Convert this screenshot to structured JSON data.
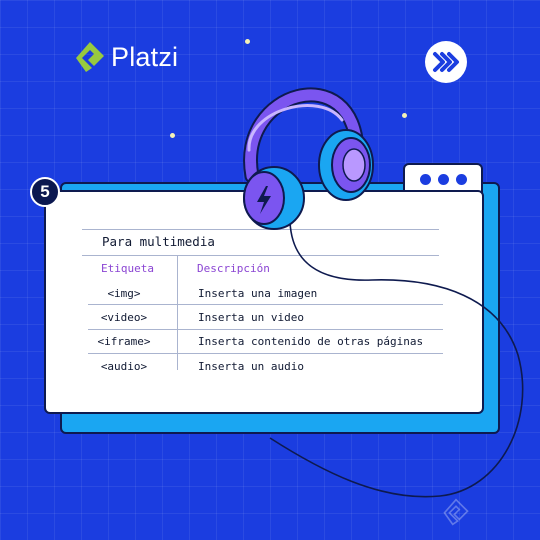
{
  "brand": {
    "name": "Platzi",
    "green": "#98ca3f",
    "blue": "#1b3de0"
  },
  "badge": {
    "number": "5"
  },
  "table": {
    "title": "Para multimedia",
    "headers": {
      "tag": "Etiqueta",
      "description": "Descripción"
    },
    "rows": [
      {
        "tag": "<img>",
        "description": "Inserta una imagen"
      },
      {
        "tag": "<video>",
        "description": "Inserta un video"
      },
      {
        "tag": "<iframe>",
        "description": "Inserta contenido de otras páginas"
      },
      {
        "tag": "<audio>",
        "description": "Inserta un audio"
      }
    ]
  },
  "icons": {
    "logo": "platzi-logo-icon",
    "fast_forward": "fast-forward-icon",
    "headphones": "headphones-icon"
  }
}
